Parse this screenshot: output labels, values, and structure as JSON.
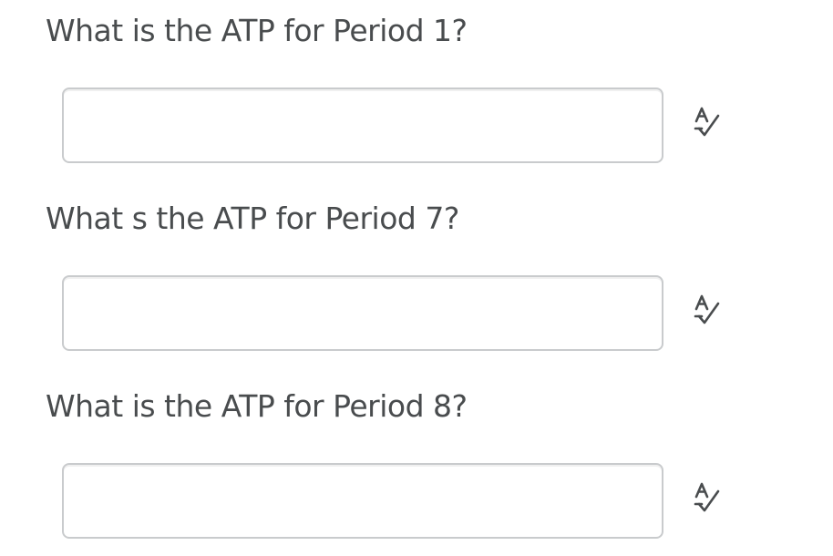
{
  "questions": [
    {
      "label": "What is the ATP for Period 1?",
      "answer_value": "",
      "icon": "spellcheck-icon"
    },
    {
      "label": "What s the ATP for Period 7?",
      "answer_value": "",
      "icon": "spellcheck-icon"
    },
    {
      "label": "What is the ATP for Period 8?",
      "answer_value": "",
      "icon": "spellcheck-icon"
    }
  ],
  "colors": {
    "text": "#494c4e",
    "input_border": "#c9cbcd",
    "icon": "#494c4e"
  }
}
